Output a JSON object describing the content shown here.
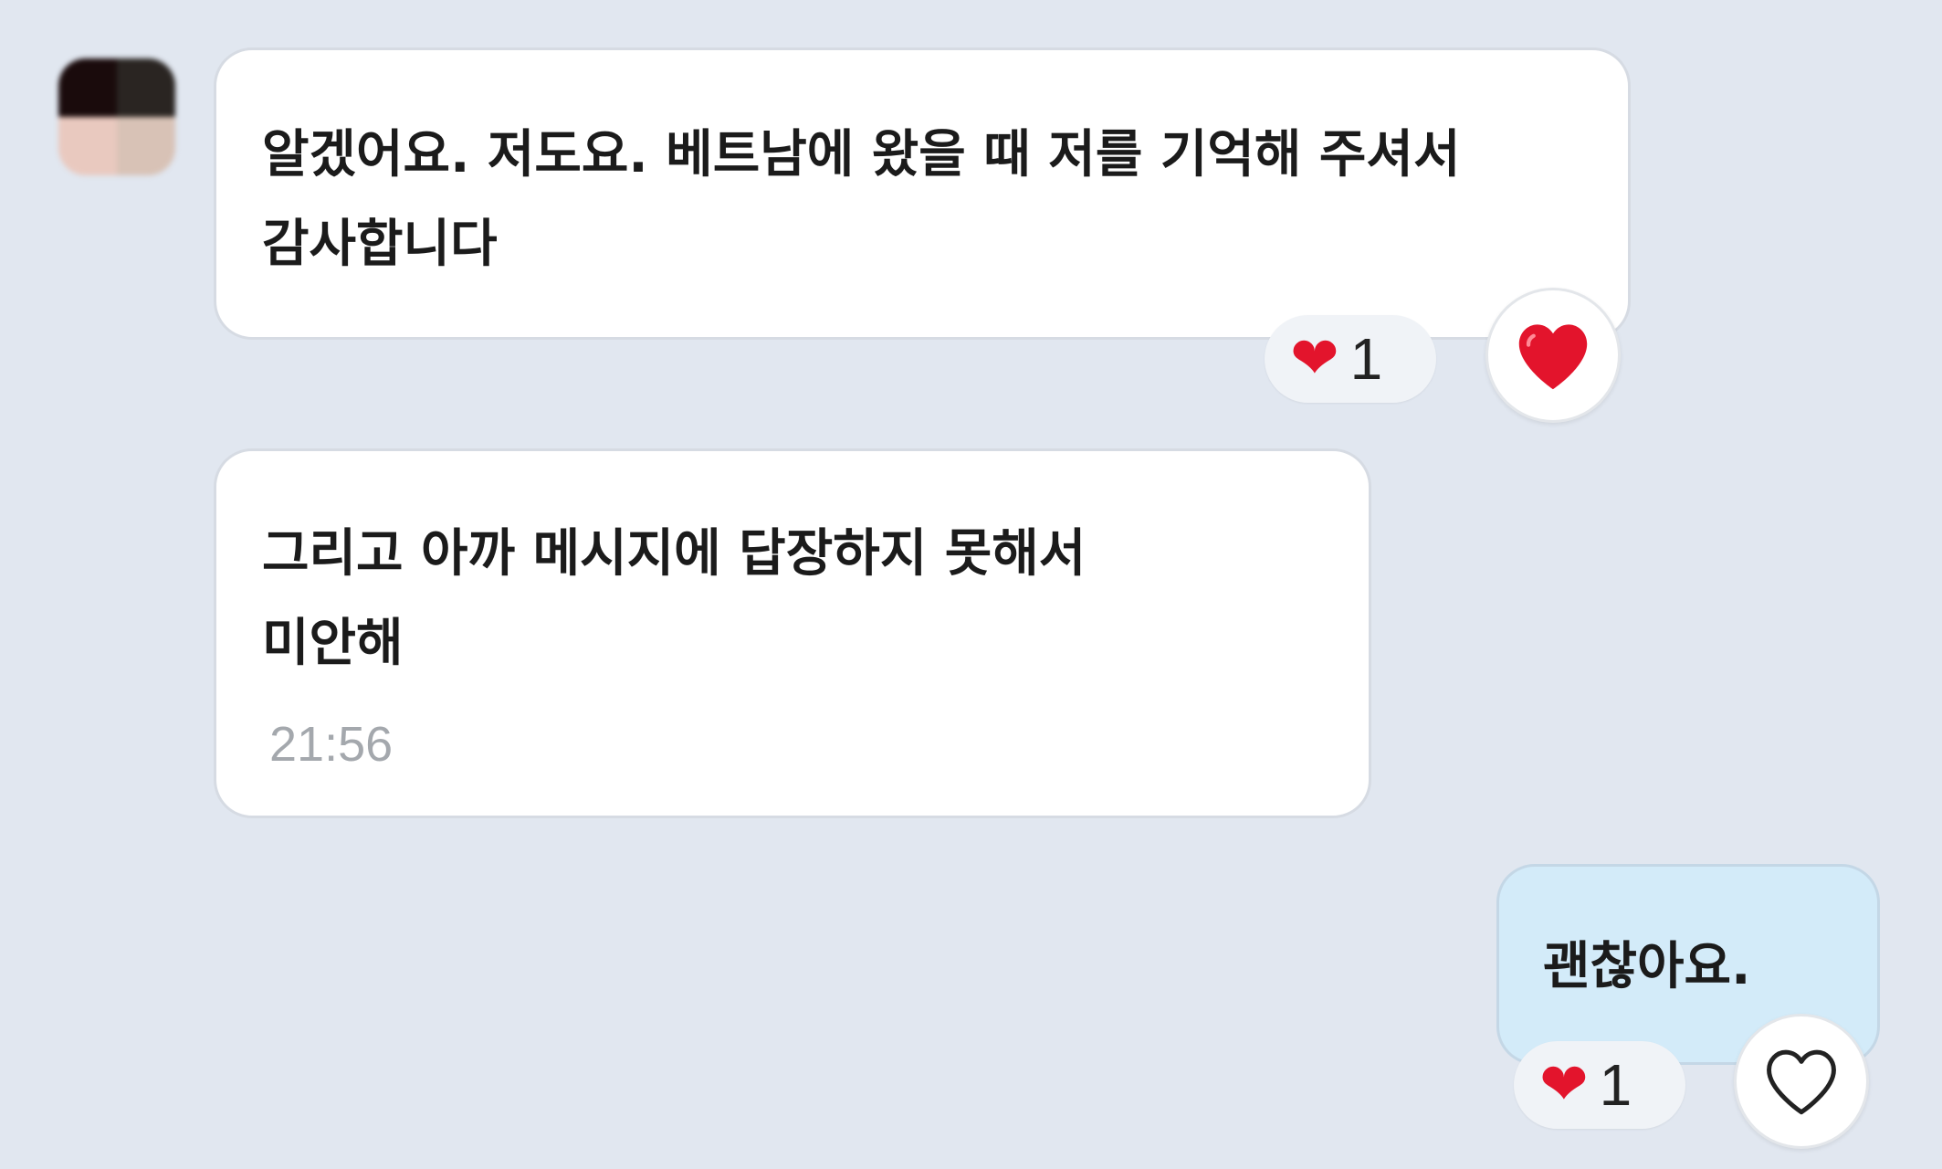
{
  "messages": [
    {
      "sender": "other",
      "text_line1": "알겠어요. 저도요. 베트남에 왔을 때 저를 기억해 주셔서",
      "text_line2": "감사합니다",
      "reaction": {
        "emoji": "❤",
        "count": "1"
      },
      "reaction_button_icon": "heart-filled"
    },
    {
      "sender": "other",
      "text_line1": "그리고 아까 메시지에 답장하지 못해서",
      "text_line2": "미안해",
      "time": "21:56"
    },
    {
      "sender": "me",
      "text_line1": "괜찮아요.",
      "reaction": {
        "emoji": "❤",
        "count": "1"
      },
      "reaction_button_icon": "heart-outline"
    }
  ],
  "colors": {
    "background": "#e1e7f0",
    "incoming_bubble": "#ffffff",
    "outgoing_bubble": "#d3ebf9",
    "heart": "#e3142c",
    "timestamp": "#a4a8ad"
  }
}
